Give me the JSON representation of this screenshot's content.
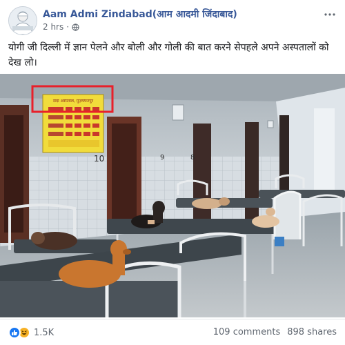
{
  "post": {
    "author": "Aam Admi Zindabad(आम आदमी जिंदाबाद)",
    "time": "2 hrs",
    "separator": "·",
    "caption": "योगी जी दिल्ली में ज्ञान पेलने और बोली और गोली की बात करने सेपहले अपने अस्पतालों को देख लो।",
    "privacy_icon": "globe-icon",
    "options_icon": "more-options-icon"
  },
  "photo": {
    "sign_heading": "सदा अस्पताल, मुज़फ्फरपुर",
    "ward_number": "10",
    "door_number_left": "9",
    "door_number_right": "8",
    "highlight_color": "#e8202a"
  },
  "footer": {
    "reaction_count": "1.5K",
    "comments": "109 comments",
    "shares": "898 shares",
    "reaction_icons": [
      "like-icon",
      "haha-icon"
    ]
  },
  "colors": {
    "author_link": "#385898",
    "like_blue": "#1877f2",
    "haha_yellow": "#f7b125",
    "muted_text": "#606770"
  }
}
